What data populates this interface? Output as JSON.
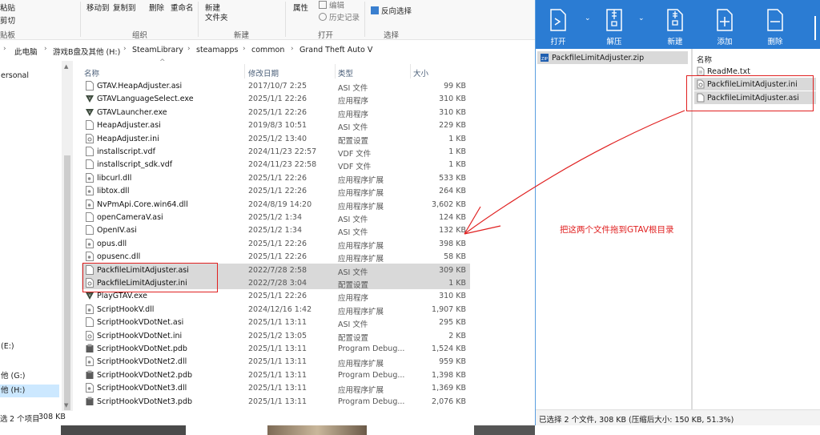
{
  "ribbon": {
    "paste": "粘贴",
    "cut": "剪切",
    "move_to": "移动到",
    "copy_to": "复制到",
    "delete": "删除",
    "rename": "重命名",
    "new_folder_line1": "新建",
    "new_folder_line2": "文件夹",
    "properties": "属性",
    "edit": "编辑",
    "history": "历史记录",
    "invert_selection": "反向选择",
    "group_clipboard": "贴板",
    "group_organize": "组织",
    "group_new": "新建",
    "group_open": "打开",
    "group_select": "选择"
  },
  "breadcrumb": [
    "此电脑",
    "游戏B盘及其他 (H:)",
    "SteamLibrary",
    "steamapps",
    "common",
    "Grand Theft Auto V"
  ],
  "nav": {
    "items": [
      {
        "label": "ersonal"
      },
      {
        "label": "(E:)"
      },
      {
        "label": "他 (G:)"
      },
      {
        "label": "他 (H:)"
      }
    ]
  },
  "columns": {
    "name": "名称",
    "date": "修改日期",
    "type": "类型",
    "size": "大小"
  },
  "files": [
    {
      "name": "GTAV.HeapAdjuster.asi",
      "date": "2017/10/7 2:25",
      "type": "ASI 文件",
      "size": "99 KB",
      "icon": "file-icon"
    },
    {
      "name": "GTAVLanguageSelect.exe",
      "date": "2025/1/1 22:26",
      "type": "应用程序",
      "size": "310 KB",
      "icon": "gta-exe-icon"
    },
    {
      "name": "GTAVLauncher.exe",
      "date": "2025/1/1 22:26",
      "type": "应用程序",
      "size": "310 KB",
      "icon": "gta-exe-icon"
    },
    {
      "name": "HeapAdjuster.asi",
      "date": "2019/8/3 10:51",
      "type": "ASI 文件",
      "size": "229 KB",
      "icon": "file-icon"
    },
    {
      "name": "HeapAdjuster.ini",
      "date": "2025/1/2 13:40",
      "type": "配置设置",
      "size": "1 KB",
      "icon": "ini-icon"
    },
    {
      "name": "installscript.vdf",
      "date": "2024/11/23 22:57",
      "type": "VDF 文件",
      "size": "1 KB",
      "icon": "file-icon"
    },
    {
      "name": "installscript_sdk.vdf",
      "date": "2024/11/23 22:58",
      "type": "VDF 文件",
      "size": "1 KB",
      "icon": "file-icon"
    },
    {
      "name": "libcurl.dll",
      "date": "2025/1/1 22:26",
      "type": "应用程序扩展",
      "size": "533 KB",
      "icon": "dll-icon"
    },
    {
      "name": "libtox.dll",
      "date": "2025/1/1 22:26",
      "type": "应用程序扩展",
      "size": "264 KB",
      "icon": "dll-icon"
    },
    {
      "name": "NvPmApi.Core.win64.dll",
      "date": "2024/8/19 14:20",
      "type": "应用程序扩展",
      "size": "3,602 KB",
      "icon": "dll-icon"
    },
    {
      "name": "openCameraV.asi",
      "date": "2025/1/2 1:34",
      "type": "ASI 文件",
      "size": "124 KB",
      "icon": "file-icon"
    },
    {
      "name": "OpenIV.asi",
      "date": "2025/1/2 1:34",
      "type": "ASI 文件",
      "size": "132 KB",
      "icon": "file-icon"
    },
    {
      "name": "opus.dll",
      "date": "2025/1/1 22:26",
      "type": "应用程序扩展",
      "size": "398 KB",
      "icon": "dll-icon"
    },
    {
      "name": "opusenc.dll",
      "date": "2025/1/1 22:26",
      "type": "应用程序扩展",
      "size": "58 KB",
      "icon": "dll-icon"
    },
    {
      "name": "PackfileLimitAdjuster.asi",
      "date": "2022/7/28 2:58",
      "type": "ASI 文件",
      "size": "309 KB",
      "icon": "file-icon",
      "selected": true
    },
    {
      "name": "PackfileLimitAdjuster.ini",
      "date": "2022/7/28 3:04",
      "type": "配置设置",
      "size": "1 KB",
      "icon": "ini-icon",
      "selected": true
    },
    {
      "name": "PlayGTAV.exe",
      "date": "2025/1/1 22:26",
      "type": "应用程序",
      "size": "310 KB",
      "icon": "gta-exe-icon"
    },
    {
      "name": "ScriptHookV.dll",
      "date": "2024/12/16 1:42",
      "type": "应用程序扩展",
      "size": "1,907 KB",
      "icon": "dll-icon"
    },
    {
      "name": "ScriptHookVDotNet.asi",
      "date": "2025/1/1 13:11",
      "type": "ASI 文件",
      "size": "295 KB",
      "icon": "file-icon"
    },
    {
      "name": "ScriptHookVDotNet.ini",
      "date": "2025/1/2 13:05",
      "type": "配置设置",
      "size": "2 KB",
      "icon": "ini-icon"
    },
    {
      "name": "ScriptHookVDotNet.pdb",
      "date": "2025/1/1 13:11",
      "type": "Program Debug...",
      "size": "1,524 KB",
      "icon": "pdb-icon"
    },
    {
      "name": "ScriptHookVDotNet2.dll",
      "date": "2025/1/1 13:11",
      "type": "应用程序扩展",
      "size": "959 KB",
      "icon": "dll-icon"
    },
    {
      "name": "ScriptHookVDotNet2.pdb",
      "date": "2025/1/1 13:11",
      "type": "Program Debug...",
      "size": "1,398 KB",
      "icon": "pdb-icon"
    },
    {
      "name": "ScriptHookVDotNet3.dll",
      "date": "2025/1/1 13:11",
      "type": "应用程序扩展",
      "size": "1,369 KB",
      "icon": "dll-icon"
    },
    {
      "name": "ScriptHookVDotNet3.pdb",
      "date": "2025/1/1 13:11",
      "type": "Program Debug...",
      "size": "2,076 KB",
      "icon": "pdb-icon"
    }
  ],
  "status": {
    "selection": "2 个项目",
    "size": "308 KB",
    "left_fragment": "选"
  },
  "archive": {
    "toolbar": {
      "open": "打开",
      "extract": "解压",
      "new": "新建",
      "add": "添加",
      "delete": "删除"
    },
    "archive_file": "PackfileLimitAdjuster.zip",
    "right_header": "名称",
    "items": [
      {
        "name": "ReadMe.txt",
        "selected": false
      },
      {
        "name": "PackfileLimitAdjuster.ini",
        "selected": true
      },
      {
        "name": "PackfileLimitAdjuster.asi",
        "selected": true
      }
    ],
    "status": "已选择 2 个文件, 308 KB (压缩后大小: 150 KB, 51.3%)"
  },
  "annotation": "把这两个文件拖到GTAV根目录",
  "colors": {
    "accent": "#2b7cd3",
    "annotation": "#e02020",
    "selection": "#d9d9d9",
    "nav_selection": "#cce8ff"
  }
}
